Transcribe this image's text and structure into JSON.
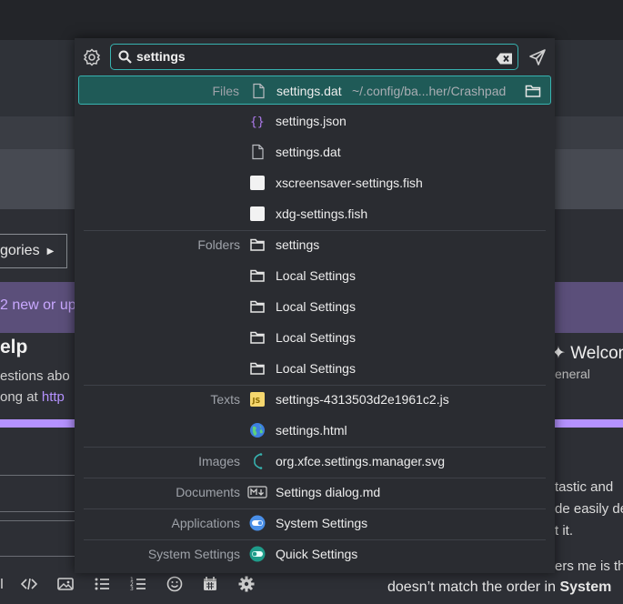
{
  "background": {
    "categories_button": "gories",
    "banner_text": "2 new or up",
    "help_title": "elp",
    "help_line1": "estions abo",
    "help_line2_prefix": "ong at ",
    "help_line2_link": "http",
    "welcome": "Welcom",
    "general": "eneral",
    "right_lines": [
      "tastic and",
      "de easily de",
      "t it.",
      "ers me is th"
    ],
    "bottom_line_prefix": "doesn’t match the order in ",
    "bottom_line_bold": "System"
  },
  "launcher": {
    "search": {
      "value": "settings",
      "placeholder": ""
    },
    "results": [
      {
        "category": "Files",
        "name": "settings.dat",
        "path": "~/.config/ba...her/Crashpad",
        "icon": "file-icon",
        "selected": true
      },
      {
        "category": "",
        "name": "settings.json",
        "icon": "json-icon"
      },
      {
        "category": "",
        "name": "settings.dat",
        "icon": "file-icon"
      },
      {
        "category": "",
        "name": "xscreensaver-settings.fish",
        "icon": "blank-file-icon"
      },
      {
        "category": "",
        "name": "xdg-settings.fish",
        "icon": "blank-file-icon"
      },
      {
        "category": "Folders",
        "name": "settings",
        "icon": "folder-icon"
      },
      {
        "category": "",
        "name": "Local Settings",
        "icon": "folder-icon"
      },
      {
        "category": "",
        "name": "Local Settings",
        "icon": "folder-icon"
      },
      {
        "category": "",
        "name": "Local Settings",
        "icon": "folder-icon"
      },
      {
        "category": "",
        "name": "Local Settings",
        "icon": "folder-icon"
      },
      {
        "category": "Texts",
        "name": "settings-4313503d2e1961c2.js",
        "icon": "javascript-icon"
      },
      {
        "category": "",
        "name": "settings.html",
        "icon": "globe-icon"
      },
      {
        "category": "Images",
        "name": "org.xfce.settings.manager.svg",
        "icon": "svg-icon"
      },
      {
        "category": "Documents",
        "name": "Settings dialog.md",
        "icon": "markdown-icon"
      },
      {
        "category": "Applications",
        "name": "System Settings",
        "icon": "system-settings-icon"
      },
      {
        "category": "System Settings",
        "name": "Quick Settings",
        "icon": "quick-settings-icon"
      }
    ]
  },
  "colors": {
    "accent": "#37b3b0",
    "selected_bg": "#1f5a57",
    "link": "#b592ff"
  }
}
